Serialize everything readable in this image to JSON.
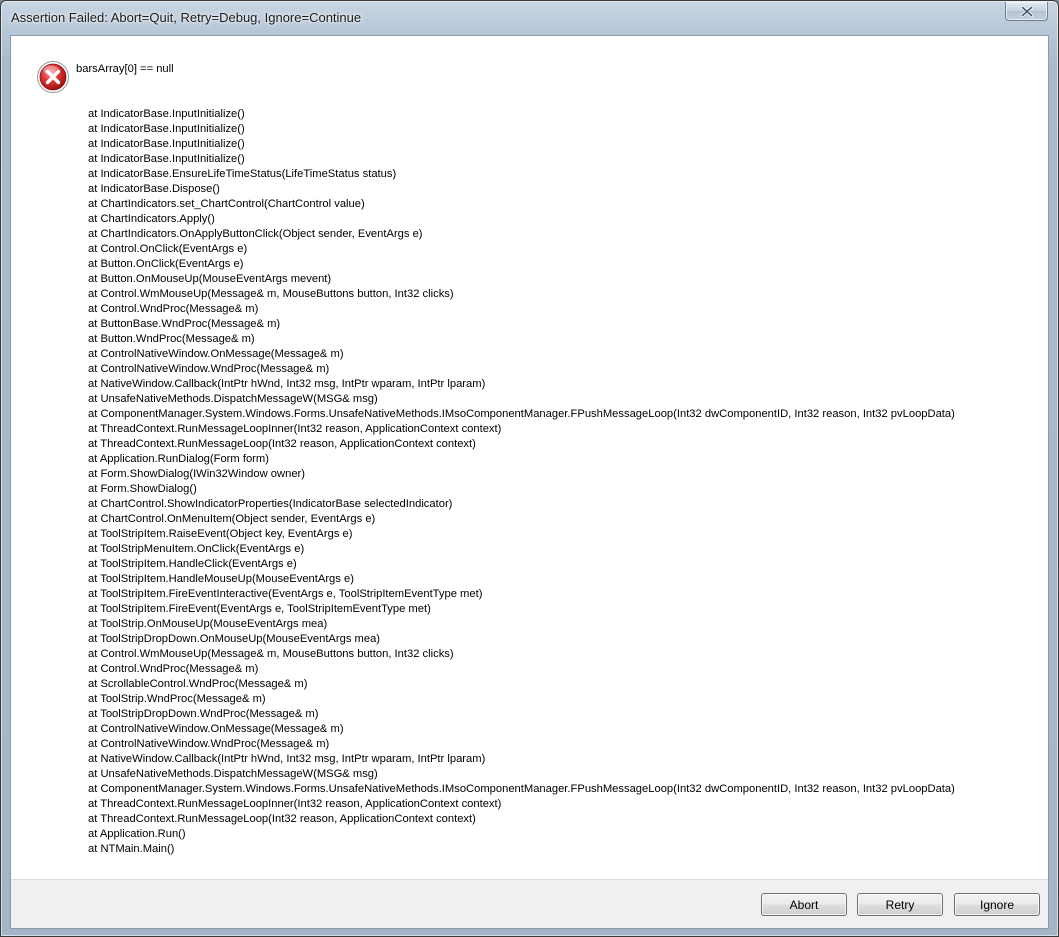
{
  "window": {
    "title": "Assertion Failed: Abort=Quit, Retry=Debug, Ignore=Continue"
  },
  "icon": "error-icon",
  "message": "barsArray[0] == null",
  "stack_trace": [
    "at IndicatorBase.InputInitialize()",
    "at IndicatorBase.InputInitialize()",
    "at IndicatorBase.InputInitialize()",
    "at IndicatorBase.InputInitialize()",
    "at IndicatorBase.EnsureLifeTimeStatus(LifeTimeStatus status)",
    "at IndicatorBase.Dispose()",
    "at ChartIndicators.set_ChartControl(ChartControl value)",
    "at ChartIndicators.Apply()",
    "at ChartIndicators.OnApplyButtonClick(Object sender, EventArgs e)",
    "at Control.OnClick(EventArgs e)",
    "at Button.OnClick(EventArgs e)",
    "at Button.OnMouseUp(MouseEventArgs mevent)",
    "at Control.WmMouseUp(Message& m, MouseButtons button, Int32 clicks)",
    "at Control.WndProc(Message& m)",
    "at ButtonBase.WndProc(Message& m)",
    "at Button.WndProc(Message& m)",
    "at ControlNativeWindow.OnMessage(Message& m)",
    "at ControlNativeWindow.WndProc(Message& m)",
    "at NativeWindow.Callback(IntPtr hWnd, Int32 msg, IntPtr wparam, IntPtr lparam)",
    "at UnsafeNativeMethods.DispatchMessageW(MSG& msg)",
    "at ComponentManager.System.Windows.Forms.UnsafeNativeMethods.IMsoComponentManager.FPushMessageLoop(Int32 dwComponentID, Int32 reason, Int32 pvLoopData)",
    "at ThreadContext.RunMessageLoopInner(Int32 reason, ApplicationContext context)",
    "at ThreadContext.RunMessageLoop(Int32 reason, ApplicationContext context)",
    "at Application.RunDialog(Form form)",
    "at Form.ShowDialog(IWin32Window owner)",
    "at Form.ShowDialog()",
    "at ChartControl.ShowIndicatorProperties(IndicatorBase selectedIndicator)",
    "at ChartControl.OnMenuItem(Object sender, EventArgs e)",
    "at ToolStripItem.RaiseEvent(Object key, EventArgs e)",
    "at ToolStripMenuItem.OnClick(EventArgs e)",
    "at ToolStripItem.HandleClick(EventArgs e)",
    "at ToolStripItem.HandleMouseUp(MouseEventArgs e)",
    "at ToolStripItem.FireEventInteractive(EventArgs e, ToolStripItemEventType met)",
    "at ToolStripItem.FireEvent(EventArgs e, ToolStripItemEventType met)",
    "at ToolStrip.OnMouseUp(MouseEventArgs mea)",
    "at ToolStripDropDown.OnMouseUp(MouseEventArgs mea)",
    "at Control.WmMouseUp(Message& m, MouseButtons button, Int32 clicks)",
    "at Control.WndProc(Message& m)",
    "at ScrollableControl.WndProc(Message& m)",
    "at ToolStrip.WndProc(Message& m)",
    "at ToolStripDropDown.WndProc(Message& m)",
    "at ControlNativeWindow.OnMessage(Message& m)",
    "at ControlNativeWindow.WndProc(Message& m)",
    "at NativeWindow.Callback(IntPtr hWnd, Int32 msg, IntPtr wparam, IntPtr lparam)",
    "at UnsafeNativeMethods.DispatchMessageW(MSG& msg)",
    "at ComponentManager.System.Windows.Forms.UnsafeNativeMethods.IMsoComponentManager.FPushMessageLoop(Int32 dwComponentID, Int32 reason, Int32 pvLoopData)",
    "at ThreadContext.RunMessageLoopInner(Int32 reason, ApplicationContext context)",
    "at ThreadContext.RunMessageLoop(Int32 reason, ApplicationContext context)",
    "at Application.Run()",
    "at NTMain.Main()"
  ],
  "buttons": {
    "abort": "Abort",
    "retry": "Retry",
    "ignore": "Ignore"
  },
  "colors": {
    "error_red": "#d42a2a",
    "frame": "#b7c7d8",
    "client_bg": "#ffffff",
    "button_area_bg": "#f0f0f0"
  }
}
